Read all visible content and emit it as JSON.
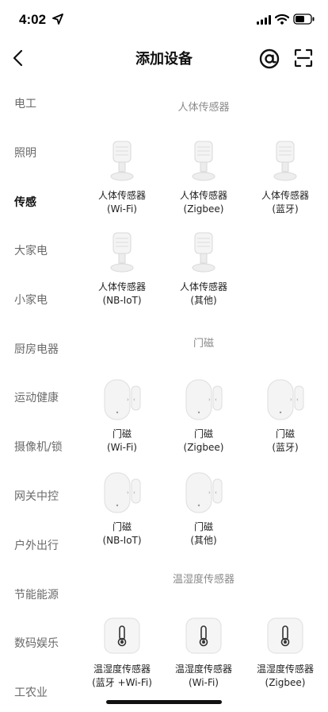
{
  "status": {
    "time": "4:02"
  },
  "nav": {
    "title": "添加设备"
  },
  "sidebar": {
    "items": [
      {
        "label": "电工"
      },
      {
        "label": "照明"
      },
      {
        "label": "传感"
      },
      {
        "label": "大家电"
      },
      {
        "label": "小家电"
      },
      {
        "label": "厨房电器"
      },
      {
        "label": "运动健康"
      },
      {
        "label": "摄像机/锁"
      },
      {
        "label": "网关中控"
      },
      {
        "label": "户外出行"
      },
      {
        "label": "节能能源"
      },
      {
        "label": "数码娱乐"
      },
      {
        "label": "工农业"
      }
    ],
    "active": "传感"
  },
  "sections": [
    {
      "title": "人体传感器",
      "icon": "motion-sensor-icon",
      "devices": [
        {
          "name": "人体传感器",
          "sub": "(Wi-Fi)"
        },
        {
          "name": "人体传感器",
          "sub": "(Zigbee)"
        },
        {
          "name": "人体传感器",
          "sub": "(蓝牙)"
        },
        {
          "name": "人体传感器",
          "sub": "(NB-IoT)"
        },
        {
          "name": "人体传感器",
          "sub": "(其他)"
        }
      ]
    },
    {
      "title": "门磁",
      "icon": "door-sensor-icon",
      "devices": [
        {
          "name": "门磁",
          "sub": "(Wi-Fi)"
        },
        {
          "name": "门磁",
          "sub": "(Zigbee)"
        },
        {
          "name": "门磁",
          "sub": "(蓝牙)"
        },
        {
          "name": "门磁",
          "sub": "(NB-IoT)"
        },
        {
          "name": "门磁",
          "sub": "(其他)"
        }
      ]
    },
    {
      "title": "温湿度传感器",
      "icon": "thermometer-sensor-icon",
      "devices": [
        {
          "name": "温湿度传感器",
          "sub": "(蓝牙 +Wi-Fi)"
        },
        {
          "name": "温湿度传感器",
          "sub": "(Wi-Fi)"
        },
        {
          "name": "温湿度传感器",
          "sub": "(Zigbee)"
        }
      ]
    }
  ],
  "colors": {
    "active_text": "#111111",
    "inactive_text": "#6a6a6a",
    "section_title": "#8a8a8a"
  }
}
